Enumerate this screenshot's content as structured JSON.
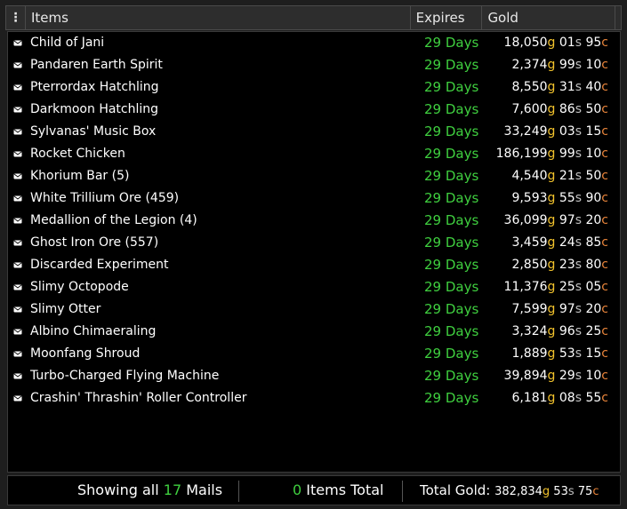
{
  "header": {
    "menu_icon": "kebab-menu-icon",
    "col_items": "Items",
    "col_expires": "Expires",
    "col_gold": "Gold"
  },
  "rows": [
    {
      "name": "Child of Jani",
      "expires": "29 Days",
      "gold": "18,050",
      "silver": "01",
      "copper": "95"
    },
    {
      "name": "Pandaren Earth Spirit",
      "expires": "29 Days",
      "gold": "2,374",
      "silver": "99",
      "copper": "10"
    },
    {
      "name": "Pterrordax Hatchling",
      "expires": "29 Days",
      "gold": "8,550",
      "silver": "31",
      "copper": "40"
    },
    {
      "name": "Darkmoon Hatchling",
      "expires": "29 Days",
      "gold": "7,600",
      "silver": "86",
      "copper": "50"
    },
    {
      "name": "Sylvanas' Music Box",
      "expires": "29 Days",
      "gold": "33,249",
      "silver": "03",
      "copper": "15"
    },
    {
      "name": "Rocket Chicken",
      "expires": "29 Days",
      "gold": "186,199",
      "silver": "99",
      "copper": "10"
    },
    {
      "name": "Khorium Bar (5)",
      "expires": "29 Days",
      "gold": "4,540",
      "silver": "21",
      "copper": "50"
    },
    {
      "name": "White Trillium Ore (459)",
      "expires": "29 Days",
      "gold": "9,593",
      "silver": "55",
      "copper": "90"
    },
    {
      "name": "Medallion of the Legion (4)",
      "expires": "29 Days",
      "gold": "36,099",
      "silver": "97",
      "copper": "20"
    },
    {
      "name": "Ghost Iron Ore (557)",
      "expires": "29 Days",
      "gold": "3,459",
      "silver": "24",
      "copper": "85"
    },
    {
      "name": "Discarded Experiment",
      "expires": "29 Days",
      "gold": "2,850",
      "silver": "23",
      "copper": "80"
    },
    {
      "name": "Slimy Octopode",
      "expires": "29 Days",
      "gold": "11,376",
      "silver": "25",
      "copper": "05"
    },
    {
      "name": "Slimy Otter",
      "expires": "29 Days",
      "gold": "7,599",
      "silver": "97",
      "copper": "20"
    },
    {
      "name": "Albino Chimaeraling",
      "expires": "29 Days",
      "gold": "3,324",
      "silver": "96",
      "copper": "25"
    },
    {
      "name": "Moonfang Shroud",
      "expires": "29 Days",
      "gold": "1,889",
      "silver": "53",
      "copper": "15"
    },
    {
      "name": "Turbo-Charged Flying Machine",
      "expires": "29 Days",
      "gold": "39,894",
      "silver": "29",
      "copper": "10"
    },
    {
      "name": "Crashin' Thrashin' Roller Controller",
      "expires": "29 Days",
      "gold": "6,181",
      "silver": "08",
      "copper": "55"
    }
  ],
  "units": {
    "gold": "g",
    "silver": "s",
    "copper": "c"
  },
  "row_icon": "mail-envelope-icon",
  "footer": {
    "showing_prefix": "Showing all",
    "mail_count": "17",
    "showing_suffix": "Mails",
    "items_count": "0",
    "items_label": "Items Total",
    "total_label": "Total Gold:",
    "total_gold": "382,834",
    "total_silver": "53",
    "total_copper": "75"
  },
  "colors": {
    "gold_unit": "#f2c22c",
    "silver_unit": "#c0c0c0",
    "copper_unit": "#e8843a",
    "expires_green": "#3fcf3f",
    "background": "#000000"
  }
}
